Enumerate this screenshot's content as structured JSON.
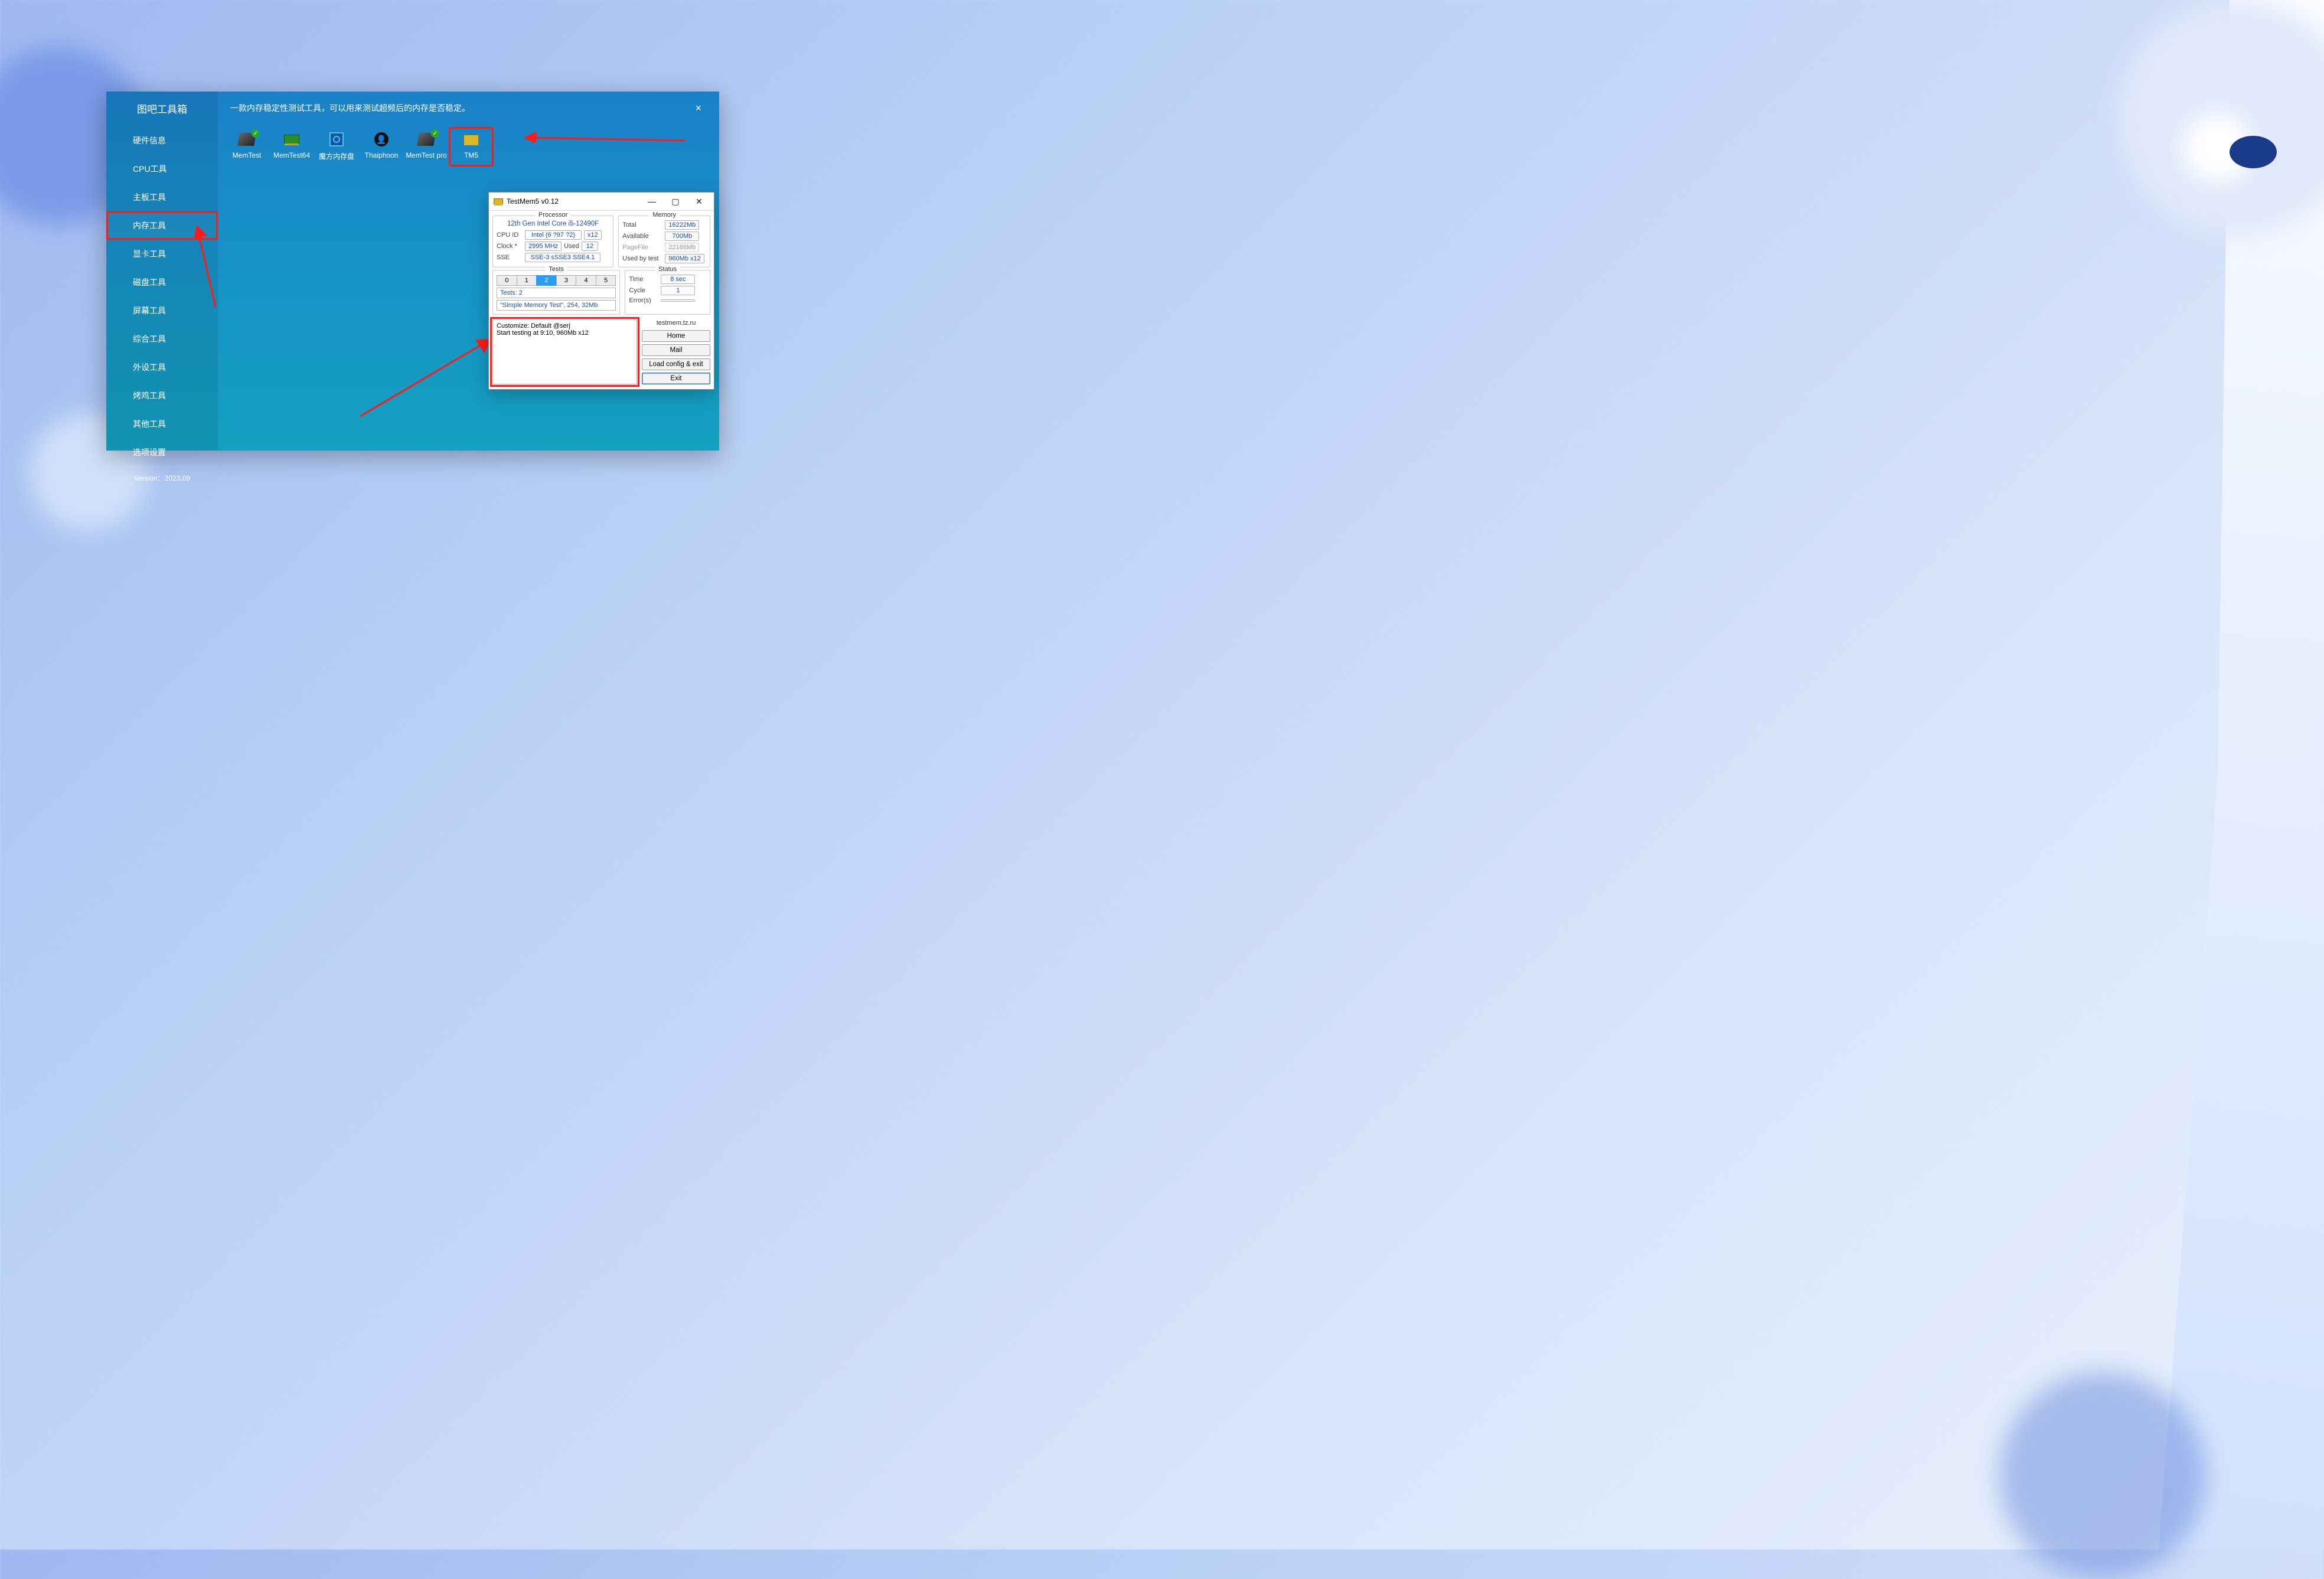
{
  "app": {
    "title": "图吧工具箱",
    "version": "Version：2023.09"
  },
  "sidebar": {
    "items": [
      {
        "label": "硬件信息"
      },
      {
        "label": "CPU工具"
      },
      {
        "label": "主板工具"
      },
      {
        "label": "内存工具"
      },
      {
        "label": "显卡工具"
      },
      {
        "label": "磁盘工具"
      },
      {
        "label": "屏幕工具"
      },
      {
        "label": "综合工具"
      },
      {
        "label": "外设工具"
      },
      {
        "label": "烤鸡工具"
      },
      {
        "label": "其他工具"
      },
      {
        "label": "选项设置"
      }
    ],
    "selected_index": 3
  },
  "content": {
    "description": "一款内存稳定性测试工具，可以用来测试超频后的内存是否稳定。",
    "tools": [
      {
        "label": "MemTest"
      },
      {
        "label": "MemTest64"
      },
      {
        "label": "魔方内存盘"
      },
      {
        "label": "Thaiphoon"
      },
      {
        "label": "MemTest pro"
      },
      {
        "label": "TM5"
      }
    ],
    "highlight_index": 5
  },
  "tm5": {
    "title": "TestMem5 v0.12",
    "processor": {
      "heading": "Processor",
      "name": "12th Gen Intel Core i5-12490F",
      "cpu_id_label": "CPU ID",
      "cpu_id_value": "Intel  (6 ?97 ?2)",
      "cpu_id_mult": "x12",
      "clock_label": "Clock *",
      "clock_value": "2995 MHz",
      "used_label": "Used",
      "used_value": "12",
      "sse_label": "SSE",
      "sse_value": "SSE-3 sSSE3 SSE4.1"
    },
    "memory": {
      "heading": "Memory",
      "total_label": "Total",
      "total_value": "16222Mb",
      "avail_label": "Available",
      "avail_value": "700Mb",
      "page_label": "PageFile",
      "page_value": "22168Mb",
      "used_label": "Used by test",
      "used_value": "960Mb x12"
    },
    "tests": {
      "heading": "Tests",
      "segments": [
        "0",
        "1",
        "2",
        "3",
        "4",
        "5"
      ],
      "active_segment": 2,
      "count_label": "Tests: 2",
      "desc": "\"Simple Memory Test\", 254, 32Mb"
    },
    "status": {
      "heading": "Status",
      "time_label": "Time",
      "time_value": "8 sec",
      "cycle_label": "Cycle",
      "cycle_value": "1",
      "error_label": "Error(s)",
      "error_value": ""
    },
    "log": {
      "line1": "Customize: Default @serj",
      "line2": "Start testing at 9:10, 960Mb x12"
    },
    "links": {
      "heading": "testmem.tz.ru",
      "home": "Home",
      "mail": "Mail",
      "load": "Load config & exit",
      "exit": "Exit"
    }
  }
}
